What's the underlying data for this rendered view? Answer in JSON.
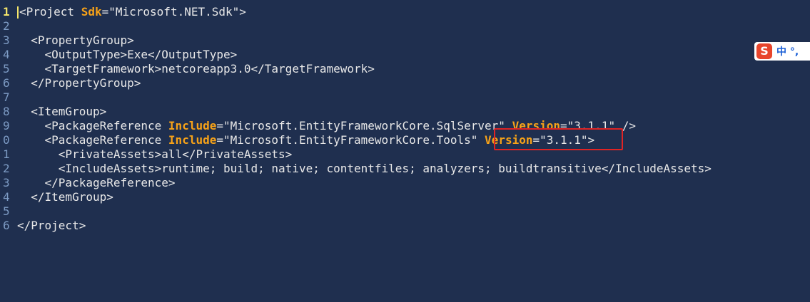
{
  "editor": {
    "lines": [
      {
        "number": "1",
        "segments": [
          {
            "t": "<Project ",
            "c": "tag"
          },
          {
            "t": "Sdk",
            "c": "attr"
          },
          {
            "t": "=\"Microsoft.NET.Sdk\">",
            "c": "str"
          }
        ]
      },
      {
        "number": "2",
        "segments": []
      },
      {
        "number": "3",
        "segments": [
          {
            "t": "  <PropertyGroup>",
            "c": "tag"
          }
        ]
      },
      {
        "number": "4",
        "segments": [
          {
            "t": "    <OutputType>Exe</OutputType>",
            "c": "tag"
          }
        ]
      },
      {
        "number": "5",
        "segments": [
          {
            "t": "    <TargetFramework>netcoreapp3.0</TargetFramework>",
            "c": "tag"
          }
        ]
      },
      {
        "number": "6",
        "segments": [
          {
            "t": "  </PropertyGroup>",
            "c": "tag"
          }
        ]
      },
      {
        "number": "7",
        "segments": []
      },
      {
        "number": "8",
        "segments": [
          {
            "t": "  <ItemGroup>",
            "c": "tag"
          }
        ]
      },
      {
        "number": "9",
        "segments": [
          {
            "t": "    <PackageReference ",
            "c": "tag"
          },
          {
            "t": "Include",
            "c": "attr"
          },
          {
            "t": "=\"Microsoft.EntityFrameworkCore.SqlServer\" ",
            "c": "str"
          },
          {
            "t": "Version",
            "c": "attr"
          },
          {
            "t": "=\"3.1.1\" />",
            "c": "str"
          }
        ]
      },
      {
        "number": "0",
        "segments": [
          {
            "t": "    <PackageReference ",
            "c": "tag"
          },
          {
            "t": "Include",
            "c": "attr"
          },
          {
            "t": "=\"Microsoft.EntityFrameworkCore.Tools\" ",
            "c": "str"
          },
          {
            "t": "Version",
            "c": "attr"
          },
          {
            "t": "=\"3.1.1\">",
            "c": "str"
          }
        ]
      },
      {
        "number": "1",
        "segments": [
          {
            "t": "      <PrivateAssets>all</PrivateAssets>",
            "c": "tag"
          }
        ]
      },
      {
        "number": "2",
        "segments": [
          {
            "t": "      <IncludeAssets>runtime; build; native; contentfiles; analyzers; buildtransitive</IncludeAssets>",
            "c": "tag"
          }
        ]
      },
      {
        "number": "3",
        "segments": [
          {
            "t": "    </PackageReference>",
            "c": "tag"
          }
        ]
      },
      {
        "number": "4",
        "segments": [
          {
            "t": "  </ItemGroup>",
            "c": "tag"
          }
        ]
      },
      {
        "number": "5",
        "segments": []
      },
      {
        "number": "6",
        "segments": [
          {
            "t": "</Project>",
            "c": "tag"
          }
        ]
      }
    ]
  },
  "ime": {
    "logo": "S",
    "text": "中 °,"
  }
}
